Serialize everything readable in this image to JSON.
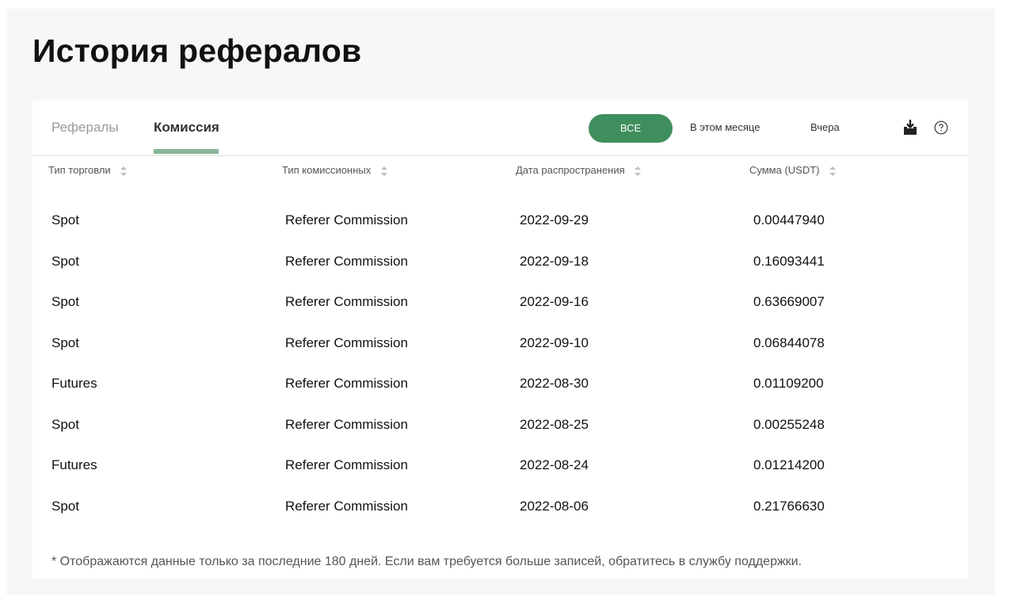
{
  "page": {
    "title": "История рефералов"
  },
  "tabs": [
    {
      "label": "Рефералы",
      "active": false
    },
    {
      "label": "Комиссия",
      "active": true
    }
  ],
  "filters": {
    "all_label": "ВСЕ",
    "this_month_label": "В этом месяце",
    "yesterday_label": "Вчера",
    "selected": "ВСЕ"
  },
  "toolbar": {
    "download_icon": "download-icon",
    "help_icon": "help-circle-icon"
  },
  "table": {
    "columns": [
      "Тип торговли",
      "Тип комиссионных",
      "Дата распространения",
      "Сумма (USDT)"
    ],
    "rows": [
      [
        "Spot",
        "Referer Commission",
        "2022-09-29",
        "0.00447940"
      ],
      [
        "Spot",
        "Referer Commission",
        "2022-09-18",
        "0.16093441"
      ],
      [
        "Spot",
        "Referer Commission",
        "2022-09-16",
        "0.63669007"
      ],
      [
        "Spot",
        "Referer Commission",
        "2022-09-10",
        "0.06844078"
      ],
      [
        "Futures",
        "Referer Commission",
        "2022-08-30",
        "0.01109200"
      ],
      [
        "Spot",
        "Referer Commission",
        "2022-08-25",
        "0.00255248"
      ],
      [
        "Futures",
        "Referer Commission",
        "2022-08-24",
        "0.01214200"
      ],
      [
        "Spot",
        "Referer Commission",
        "2022-08-06",
        "0.21766630"
      ]
    ]
  },
  "footnote": "* Отображаются данные только за последние 180 дней. Если вам требуется больше записей, обратитесь в службу поддержки.",
  "colors": {
    "accent": "#3f8e5d",
    "tab_underline": "#86b797",
    "page_bg": "#f7f7f7"
  }
}
